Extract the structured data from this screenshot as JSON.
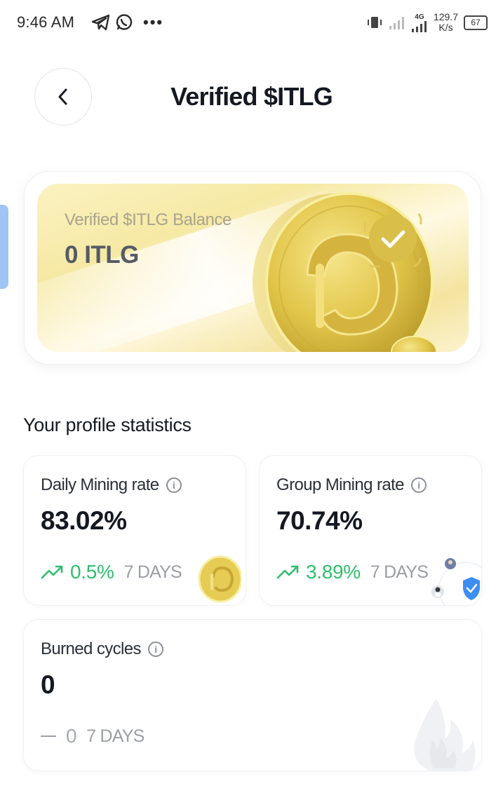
{
  "status_bar": {
    "time": "9:46 AM",
    "network_type": "4G",
    "speed_value": "129.7",
    "speed_unit": "K/s",
    "battery": "67"
  },
  "header": {
    "title": "Verified $ITLG",
    "back_icon": "chevron-left-icon"
  },
  "balance": {
    "label": "Verified $ITLG Balance",
    "value": "0 ITLG"
  },
  "stats": {
    "section_title": "Your profile statistics",
    "daily": {
      "label": "Daily Mining rate",
      "value": "83.02%",
      "change": "0.5%",
      "period": "7 DAYS"
    },
    "group": {
      "label": "Group Mining rate",
      "value": "70.74%",
      "change": "3.89%",
      "period": "7 DAYS"
    },
    "burned": {
      "label": "Burned cycles",
      "value": "0",
      "change": "0",
      "period": "7 DAYS"
    }
  },
  "colors": {
    "accent_green": "#2fbf6b",
    "coin_gold": "#e3c54a",
    "card_bg_gold": "#f7ebb0",
    "edge_tab_blue": "#9ec5f5"
  }
}
